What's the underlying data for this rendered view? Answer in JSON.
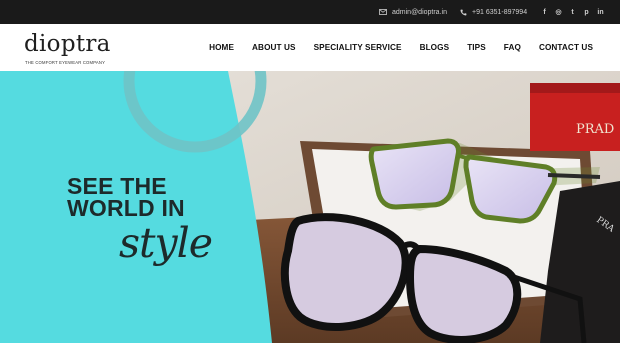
{
  "topbar": {
    "email": "admin@dioptra.in",
    "phone": "+91 6351-897994",
    "social_icons": [
      "facebook-icon",
      "instagram-icon",
      "twitter-icon",
      "pinterest-icon",
      "linkedin-icon"
    ],
    "social_glyphs": [
      "f",
      "◎",
      "t",
      "p",
      "in"
    ]
  },
  "logo": {
    "wordmark": "dioptra",
    "tagline": "THE COMFORT EYEWEAR COMPANY"
  },
  "nav": {
    "items": [
      "HOME",
      "ABOUT US",
      "SPECIALITY SERVICE",
      "BLOGS",
      "TIPS",
      "FAQ",
      "CONTACT US"
    ]
  },
  "hero": {
    "line1": "SEE THE",
    "line2": "WORLD IN",
    "line3": "style",
    "box_brand": "PRAD",
    "pouch_brand": "PRA",
    "colors": {
      "turquoise": "#55dbe0",
      "ring": "#6fc3c7",
      "headline": "#1d2a2b",
      "box_red": "#c8201f",
      "frame_green": "#6b8a2f"
    }
  }
}
